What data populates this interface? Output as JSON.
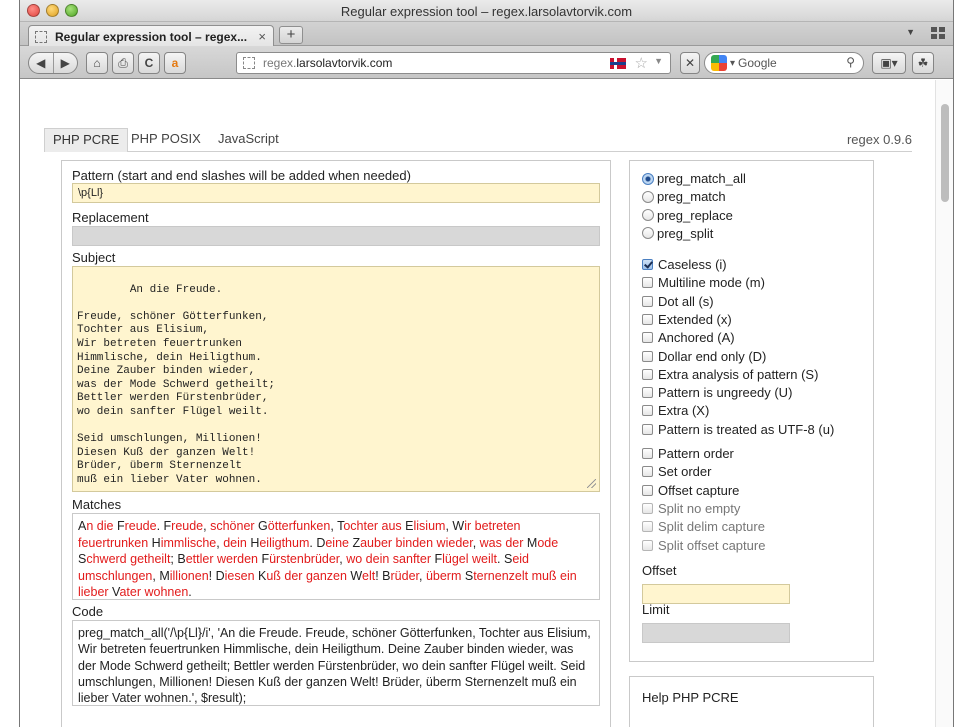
{
  "window": {
    "title": "Regular expression tool – regex.larsolavtorvik.com"
  },
  "tabs": [
    {
      "label": "Regular expression tool – regex...",
      "close": "×"
    }
  ],
  "new_tab_label": "+",
  "toolbar": {
    "back": "◀",
    "forward": "▶",
    "home": "⌂",
    "print": "⎙",
    "reload": "C",
    "amazon": "a",
    "url_host": "regex.larsolavtorvik.com",
    "search_placeholder": "Google",
    "search_engine_arrow": "▾",
    "stop": "✕"
  },
  "nav": {
    "tabs": [
      "PHP PCRE",
      "PHP POSIX",
      "JavaScript"
    ],
    "active": "PHP PCRE",
    "version": "regex 0.9.6"
  },
  "form": {
    "pattern_label": "Pattern (start and end slashes will be added when needed)",
    "pattern_value": "\\p{Ll}",
    "replacement_label": "Replacement",
    "replacement_value": "",
    "subject_label": "Subject",
    "subject_value": "An die Freude.\n\nFreude, schöner Götterfunken,\nTochter aus Elisium,\nWir betreten feuertrunken\nHimmlische, dein Heiligthum.\nDeine Zauber binden wieder,\nwas der Mode Schwerd getheilt;\nBettler werden Fürstenbrüder,\nwo dein sanfter Flügel weilt.\n\nSeid umschlungen, Millionen!\nDiesen Kuß der ganzen Welt!\nBrüder, überm Sternenzelt\nmuß ein lieber Vater wohnen.",
    "matches_label": "Matches",
    "matches_segments": [
      {
        "t": "A",
        "m": false
      },
      {
        "t": "n die ",
        "m": true
      },
      {
        "t": "F",
        "m": false
      },
      {
        "t": "reude",
        "m": true
      },
      {
        "t": ". ",
        "m": false
      },
      {
        "t": "F",
        "m": false
      },
      {
        "t": "reude",
        "m": true
      },
      {
        "t": ", ",
        "m": false
      },
      {
        "t": "schöner",
        "m": true
      },
      {
        "t": " G",
        "m": false
      },
      {
        "t": "ötterfunken",
        "m": true
      },
      {
        "t": ", ",
        "m": false
      },
      {
        "t": "T",
        "m": false
      },
      {
        "t": "ochter aus",
        "m": true
      },
      {
        "t": " E",
        "m": false
      },
      {
        "t": "lisium",
        "m": true
      },
      {
        "t": ", ",
        "m": false
      },
      {
        "t": "W",
        "m": false
      },
      {
        "t": "ir betreten feuertrunken",
        "m": true
      },
      {
        "t": " H",
        "m": false
      },
      {
        "t": "immlische",
        "m": true
      },
      {
        "t": ", ",
        "m": false
      },
      {
        "t": "dein",
        "m": true
      },
      {
        "t": " H",
        "m": false
      },
      {
        "t": "eiligthum",
        "m": true
      },
      {
        "t": ". ",
        "m": false
      },
      {
        "t": "D",
        "m": false
      },
      {
        "t": "eine",
        "m": true
      },
      {
        "t": " Z",
        "m": false
      },
      {
        "t": "auber binden wieder",
        "m": true
      },
      {
        "t": ", ",
        "m": false
      },
      {
        "t": "was der",
        "m": true
      },
      {
        "t": " M",
        "m": false
      },
      {
        "t": "ode",
        "m": true
      },
      {
        "t": " S",
        "m": false
      },
      {
        "t": "chwerd getheilt",
        "m": true
      },
      {
        "t": "; ",
        "m": false
      },
      {
        "t": "B",
        "m": false
      },
      {
        "t": "ettler werden",
        "m": true
      },
      {
        "t": " F",
        "m": false
      },
      {
        "t": "ürstenbrüder",
        "m": true
      },
      {
        "t": ", ",
        "m": false
      },
      {
        "t": "wo dein sanfter",
        "m": true
      },
      {
        "t": " F",
        "m": false
      },
      {
        "t": "lügel weilt",
        "m": true
      },
      {
        "t": ". ",
        "m": false
      },
      {
        "t": "S",
        "m": false
      },
      {
        "t": "eid umschlungen",
        "m": true
      },
      {
        "t": ", ",
        "m": false
      },
      {
        "t": "M",
        "m": false
      },
      {
        "t": "illionen",
        "m": true
      },
      {
        "t": "! ",
        "m": false
      },
      {
        "t": "D",
        "m": false
      },
      {
        "t": "iesen",
        "m": true
      },
      {
        "t": " K",
        "m": false
      },
      {
        "t": "uß der ganzen",
        "m": true
      },
      {
        "t": " W",
        "m": false
      },
      {
        "t": "elt",
        "m": true
      },
      {
        "t": "! ",
        "m": false
      },
      {
        "t": "B",
        "m": false
      },
      {
        "t": "rüder",
        "m": true
      },
      {
        "t": ", ",
        "m": false
      },
      {
        "t": "überm",
        "m": true
      },
      {
        "t": " S",
        "m": false
      },
      {
        "t": "ternenzelt muß ein lieber",
        "m": true
      },
      {
        "t": " V",
        "m": false
      },
      {
        "t": "ater wohnen",
        "m": true
      },
      {
        "t": ".",
        "m": false
      }
    ],
    "code_label": "Code",
    "code_value": "preg_match_all('/\\p{Ll}/i', 'An die Freude. Freude, schöner Götterfunken, Tochter aus Elisium, Wir betreten feuertrunken Himmlische, dein Heiligthum. Deine Zauber binden wieder, was der Mode Schwerd getheilt; Bettler werden Fürstenbrüder, wo dein sanfter Flügel weilt. Seid umschlungen, Millionen! Diesen Kuß der ganzen Welt! Brüder, überm Sternenzelt muß ein lieber Vater wohnen.', $result);"
  },
  "functions": [
    {
      "label": "preg_match_all",
      "selected": true
    },
    {
      "label": "preg_match",
      "selected": false
    },
    {
      "label": "preg_replace",
      "selected": false
    },
    {
      "label": "preg_split",
      "selected": false
    }
  ],
  "modifiers": [
    {
      "label": "Caseless (i)",
      "checked": true
    },
    {
      "label": "Multiline mode (m)",
      "checked": false
    },
    {
      "label": "Dot all (s)",
      "checked": false
    },
    {
      "label": "Extended (x)",
      "checked": false
    },
    {
      "label": "Anchored (A)",
      "checked": false
    },
    {
      "label": "Dollar end only (D)",
      "checked": false
    },
    {
      "label": "Extra analysis of pattern (S)",
      "checked": false
    },
    {
      "label": "Pattern is ungreedy (U)",
      "checked": false
    },
    {
      "label": "Extra (X)",
      "checked": false
    },
    {
      "label": "Pattern is treated as UTF-8 (u)",
      "checked": false
    }
  ],
  "flags": [
    {
      "label": "Pattern order",
      "checked": false,
      "enabled": true
    },
    {
      "label": "Set order",
      "checked": false,
      "enabled": true
    },
    {
      "label": "Offset capture",
      "checked": false,
      "enabled": true
    },
    {
      "label": "Split no empty",
      "checked": false,
      "enabled": false
    },
    {
      "label": "Split delim capture",
      "checked": false,
      "enabled": false
    },
    {
      "label": "Split offset capture",
      "checked": false,
      "enabled": false
    }
  ],
  "offset": {
    "label": "Offset",
    "value": ""
  },
  "limit": {
    "label": "Limit",
    "value": ""
  },
  "help": {
    "title": "Help PHP PCRE"
  }
}
